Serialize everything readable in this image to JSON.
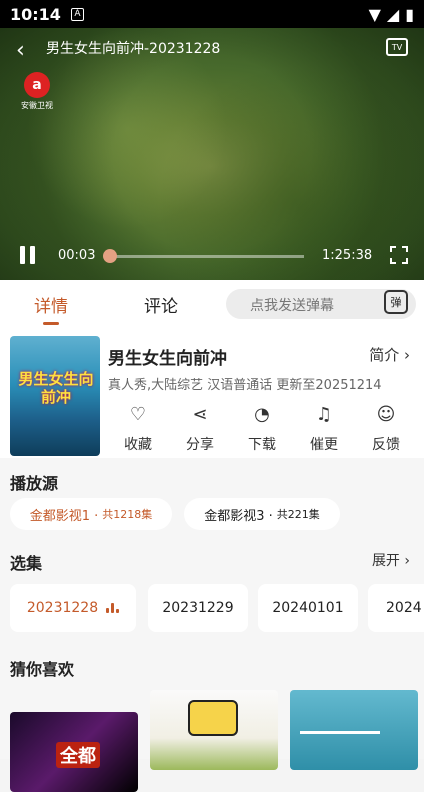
{
  "status": {
    "time": "10:14"
  },
  "player": {
    "title": "男生女生向前冲-20231228",
    "channel_logo": "安徽卫视",
    "tv_label": "TV",
    "current_time": "00:03",
    "total_time": "1:25:38",
    "progress": 0.002
  },
  "tabs": {
    "details": "详情",
    "comments": "评论",
    "danmu_placeholder": "点我发送弹幕",
    "danmu_icon": "弹"
  },
  "show": {
    "cover_text": "男生女生向前冲",
    "title": "男生女生向前冲",
    "intro_label": "简介",
    "meta": "真人秀,大陆综艺 汉语普通话 更新至20251214"
  },
  "actions": [
    {
      "label": "收藏",
      "icon": "heart-icon"
    },
    {
      "label": "分享",
      "icon": "share-icon"
    },
    {
      "label": "下载",
      "icon": "download-icon"
    },
    {
      "label": "催更",
      "icon": "bell-icon"
    },
    {
      "label": "反馈",
      "icon": "feedback-icon"
    }
  ],
  "sources": {
    "heading": "播放源",
    "items": [
      {
        "name": "金都影视1 ·",
        "count": "共1218集",
        "selected": true
      },
      {
        "name": "金都影视3 ·",
        "count": "共221集",
        "selected": false
      }
    ]
  },
  "episodes": {
    "heading": "选集",
    "expand_label": "展开",
    "items": [
      "20231228",
      "20231229",
      "20240101",
      "2024"
    ]
  },
  "recommend": {
    "heading": "猜你喜欢",
    "items": [
      "全都",
      "",
      ""
    ]
  },
  "colors": {
    "accent": "#c45a2a"
  }
}
